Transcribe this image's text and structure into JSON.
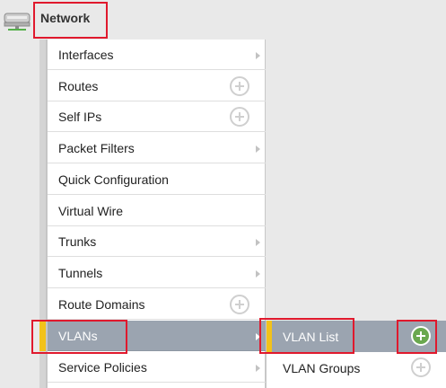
{
  "header": {
    "title": "Network",
    "icon": "network-switch-icon"
  },
  "menu": {
    "items": [
      {
        "label": "Interfaces",
        "control": "arrow"
      },
      {
        "label": "Routes",
        "control": "plus"
      },
      {
        "label": "Self IPs",
        "control": "plus"
      },
      {
        "label": "Packet Filters",
        "control": "arrow"
      },
      {
        "label": "Quick Configuration",
        "control": "none"
      },
      {
        "label": "Virtual Wire",
        "control": "none"
      },
      {
        "label": "Trunks",
        "control": "arrow"
      },
      {
        "label": "Tunnels",
        "control": "arrow"
      },
      {
        "label": "Route Domains",
        "control": "plus"
      },
      {
        "label": "VLANs",
        "control": "arrow",
        "active": true
      },
      {
        "label": "Service Policies",
        "control": "arrow"
      }
    ]
  },
  "submenu": {
    "items": [
      {
        "label": "VLAN List",
        "control": "plus",
        "active": true
      },
      {
        "label": "VLAN Groups",
        "control": "plus"
      }
    ]
  },
  "colors": {
    "active_bg": "#9ba4b0",
    "indicator": "#f2c21a",
    "highlight_box": "#e0192d",
    "add_active": "#6aa84f"
  }
}
